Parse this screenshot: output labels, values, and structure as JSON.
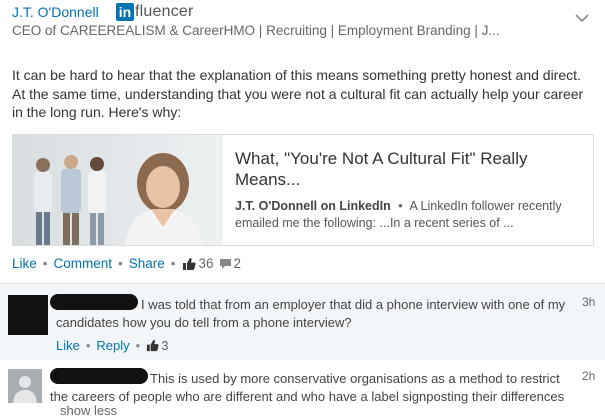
{
  "post": {
    "author_name": "J.T. O'Donnell",
    "badge_in": "in",
    "badge_word": "fluencer",
    "headline": "CEO of CAREEREALISM & CareerHMO | Recruiting | Employment Branding | J...",
    "text": "It can be hard to hear that the explanation of this means something pretty honest and direct. At the same time, understanding that you were not a cultural fit can actually help your career in the long run. Here's why:"
  },
  "article_card": {
    "title": "What, \"You're Not A Cultural Fit\" Really Means...",
    "source": "J.T. O'Donnell on LinkedIn",
    "separator": "•",
    "summary": "A LinkedIn follower recently emailed me the following: ...In a recent series of ..."
  },
  "post_actions": {
    "like": "Like",
    "comment": "Comment",
    "share": "Share",
    "like_count": "36",
    "comment_count": "2"
  },
  "comments": [
    {
      "text": "I was told that from an employer that did a phone interview with one of my candidates how you do tell from a phone interview?",
      "time": "3h",
      "like": "Like",
      "reply": "Reply",
      "like_count": "3"
    },
    {
      "text": "This is used by more conservative organisations as a method to restrict the careers of people who are different and who have a label signposting their differences",
      "time": "2h",
      "show_less": "show less"
    }
  ],
  "colors": {
    "link_blue": "#0073b1",
    "comment_bg": "#f3f6f8",
    "redaction": "#111111"
  },
  "icons": [
    "chevron-down-icon",
    "thumbs-up-icon",
    "speech-bubble-icon",
    "person-silhouette-icon"
  ]
}
